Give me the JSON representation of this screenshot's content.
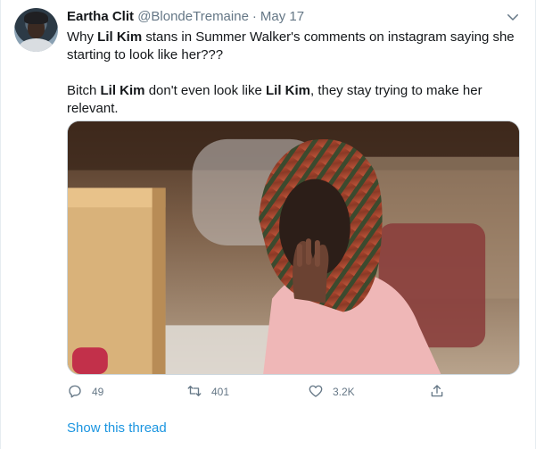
{
  "tweet": {
    "author": {
      "display_name": "Eartha Clit",
      "handle": "@BlondeTremaine",
      "separator": "·",
      "date": "May 17"
    },
    "paragraphs": [
      [
        {
          "text": "Why ",
          "bold": false
        },
        {
          "text": "Lil Kim",
          "bold": true
        },
        {
          "text": " stans in Summer Walker's comments on instagram saying she starting to look like her???",
          "bold": false
        }
      ],
      [
        {
          "text": "Bitch ",
          "bold": false
        },
        {
          "text": "Lil Kim",
          "bold": true
        },
        {
          "text": " don't even look like ",
          "bold": false
        },
        {
          "text": "Lil Kim",
          "bold": true
        },
        {
          "text": ", they stay trying to make her relevant.",
          "bold": false
        }
      ]
    ],
    "actions": {
      "reply_count": "49",
      "retweet_count": "401",
      "like_count": "3.2K"
    },
    "show_thread_label": "Show this thread"
  },
  "icons": {
    "caret": "chevron-down-icon",
    "reply": "reply-icon",
    "retweet": "retweet-icon",
    "like": "heart-icon",
    "share": "share-icon"
  },
  "colors": {
    "text_primary": "#14171a",
    "text_secondary": "#657786",
    "link": "#1b95e0",
    "border": "#e6ecf0"
  }
}
